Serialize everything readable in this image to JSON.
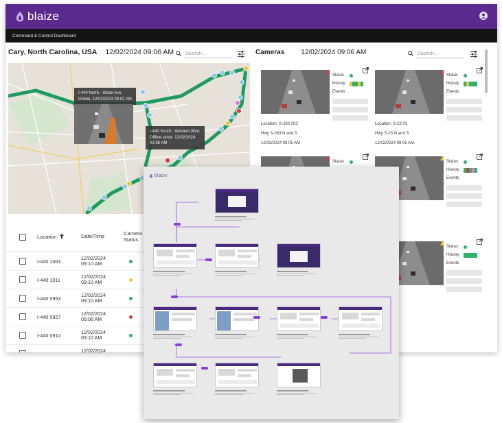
{
  "app": {
    "brand": "blaize",
    "subtitle": "Command & Control Dashboard"
  },
  "map_panel": {
    "location": "Cary, North Carolina, USA",
    "datetime": "12/02/2024 09:06 AM",
    "search_placeholder": "Search...",
    "tooltips": [
      {
        "lines": [
          "I-440 North - Wade Ave.",
          "Online, 12/02/2024 09:02 AM"
        ]
      },
      {
        "lines": [
          "I-440 South - Western Blvd.",
          "Offline since: 12/02/2024",
          "03:36 AM"
        ]
      }
    ]
  },
  "table": {
    "headers": {
      "location": "Location",
      "datetime": "Date/Time",
      "status": "Camera Status"
    },
    "rows": [
      {
        "location": "I-440 1063",
        "date": "12/02/2024",
        "time": "09:10 AM",
        "status_color": "#2fb36b"
      },
      {
        "location": "I-440 1011",
        "date": "12/02/2024",
        "time": "09:10 AM",
        "status_color": "#f0c43a"
      },
      {
        "location": "I-440 0953",
        "date": "12/02/2024",
        "time": "09:10 AM",
        "status_color": "#2fb36b"
      },
      {
        "location": "I-440 0927",
        "date": "12/02/2024",
        "time": "09:08 AM",
        "status_color": "#d9364a"
      },
      {
        "location": "I-440 0910",
        "date": "12/02/2024",
        "time": "09:10 AM",
        "status_color": "#2fb36b"
      },
      {
        "location": "I-440 0843",
        "date": "12/02/2024",
        "time": "09:10 AM",
        "status_color": "#2fb36b"
      }
    ]
  },
  "cameras_panel": {
    "title": "Cameras",
    "datetime": "12/02/2024 09:06 AM",
    "search_placeholder": "Search...",
    "labels": {
      "status": "Status",
      "history": "History",
      "events": "Events"
    },
    "cards": [
      {
        "location": "Location: S-283 203",
        "road": "Hwy S-283 N and S",
        "time": "12/02/2024 09:05 AM",
        "status_color": "#2fb36b"
      },
      {
        "location": "Location: S-23 03",
        "road": "Hwy S-23 N and S",
        "time": "12/02/2024 09:05 AM",
        "status_color": "#2fb36b"
      },
      {
        "status_color": "#2fb36b"
      },
      {
        "location": "202",
        "time": "05 AM",
        "status_color": "#2fb36b"
      },
      {
        "status_color": "#f0c43a"
      },
      {
        "road": "d S",
        "time": "05 AM",
        "status_color": "#2fb36b"
      }
    ]
  },
  "colors": {
    "brand_purple": "#5b2a8f",
    "green": "#2fb36b",
    "yellow": "#f0c43a",
    "red": "#d9364a",
    "road_green": "#1f9a62"
  }
}
